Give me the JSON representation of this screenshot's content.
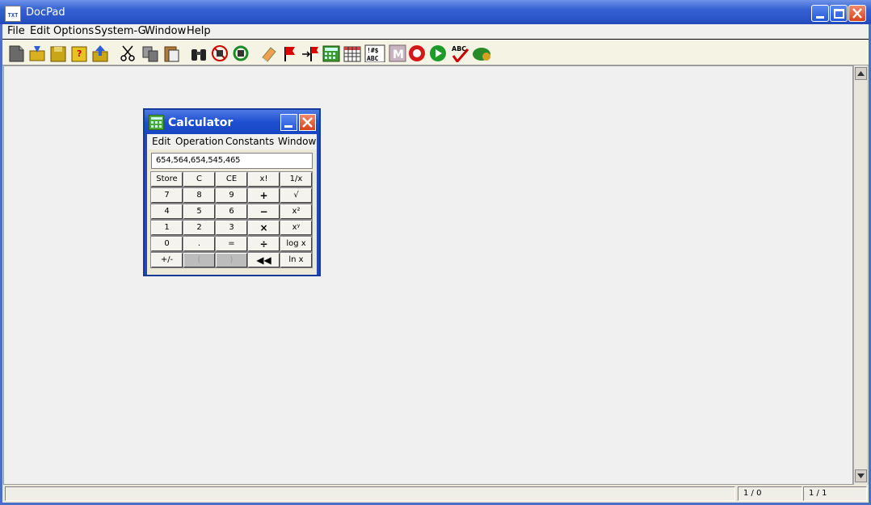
{
  "window": {
    "title": "DocPad",
    "icon": "txt-file-icon",
    "icon_text": "TXT"
  },
  "menubar": {
    "file": "File",
    "edit": "Edit",
    "options": "Options",
    "system": "System-G",
    "window": "Window",
    "help": "Help"
  },
  "toolbar": {
    "icons": [
      "new-document-icon",
      "open-folder-icon",
      "save-icon",
      "save-as-icon",
      "upload-icon",
      "cut-icon",
      "copy-icon",
      "paste-icon",
      "find-binoculars-icon",
      "no-replace-icon",
      "replace-cycle-icon",
      "eraser-icon",
      "flag-icon",
      "goto-flag-icon",
      "calculator-icon",
      "table-grid-icon",
      "special-chars-icon",
      "macro-m-icon",
      "record-icon",
      "play-icon",
      "spellcheck-icon",
      "plugin-blob-icon"
    ],
    "spellcheck_text": "ABC",
    "chars_text": "!#$ ABC",
    "macro_text": "M"
  },
  "statusbar": {
    "position": "1 / 0",
    "page": "1 / 1"
  },
  "calculator": {
    "title": "Calculator",
    "menu": {
      "edit": "Edit",
      "operation": "Operation",
      "constants": "Constants",
      "window": "Window"
    },
    "display": "654,564,654,545,465",
    "keys": [
      [
        "Store",
        "C",
        "CE",
        "x!",
        "1/x"
      ],
      [
        "7",
        "8",
        "9",
        "+",
        "√"
      ],
      [
        "4",
        "5",
        "6",
        "−",
        "x²"
      ],
      [
        "1",
        "2",
        "3",
        "×",
        "xʸ"
      ],
      [
        "0",
        ".",
        "=",
        "÷",
        "log x"
      ],
      [
        "+/-",
        "(",
        ")",
        "◀◀",
        "ln x"
      ]
    ]
  },
  "colors": {
    "titlebar": "#2b56c9",
    "close": "#d8431c",
    "workspace": "#f0f0f0"
  }
}
